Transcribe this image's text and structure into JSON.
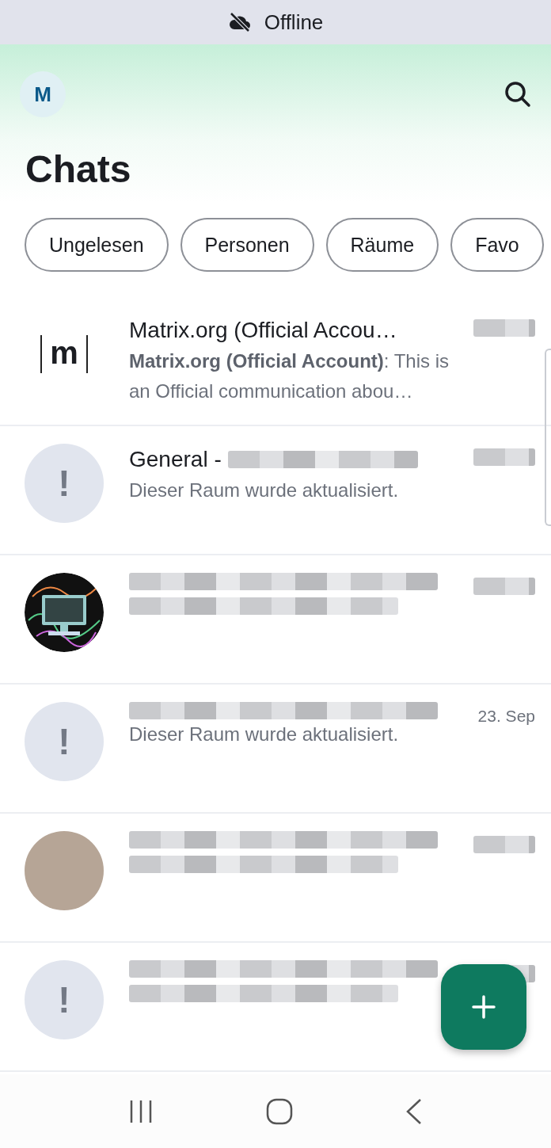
{
  "status_banner": {
    "text": "Offline"
  },
  "header": {
    "avatar_letter": "M",
    "title": "Chats"
  },
  "filters": [
    {
      "label": "Ungelesen",
      "selected": false
    },
    {
      "label": "Personen",
      "selected": false
    },
    {
      "label": "Räume",
      "selected": false
    },
    {
      "label": "Favo",
      "selected": false
    }
  ],
  "chats": [
    {
      "avatar": {
        "kind": "logo",
        "text": "m"
      },
      "name": "Matrix.org (Official Accou…",
      "name_redacted": false,
      "preview": "**Matrix.org (Official Account)**: This is an Official communication abou…",
      "preview_redacted": false,
      "time_redacted": true
    },
    {
      "avatar": {
        "kind": "warning",
        "text": "!"
      },
      "name": "General -",
      "name_redacted": true,
      "preview": "Dieser Raum wurde aktualisiert.",
      "preview_redacted": false,
      "time_redacted": true
    },
    {
      "avatar": {
        "kind": "image"
      },
      "name_redacted": true,
      "preview_redacted": true,
      "time_redacted": true
    },
    {
      "avatar": {
        "kind": "warning",
        "text": "!"
      },
      "name_redacted": true,
      "preview": "Dieser Raum wurde aktualisiert.",
      "preview_redacted": false,
      "time": "23. Sep",
      "time_redacted": false
    },
    {
      "avatar": {
        "kind": "photo"
      },
      "name_redacted": true,
      "preview_redacted": true,
      "time_redacted": true
    },
    {
      "avatar": {
        "kind": "warning",
        "text": "!"
      },
      "name_redacted": true,
      "preview_redacted": true,
      "time_redacted": true
    }
  ]
}
